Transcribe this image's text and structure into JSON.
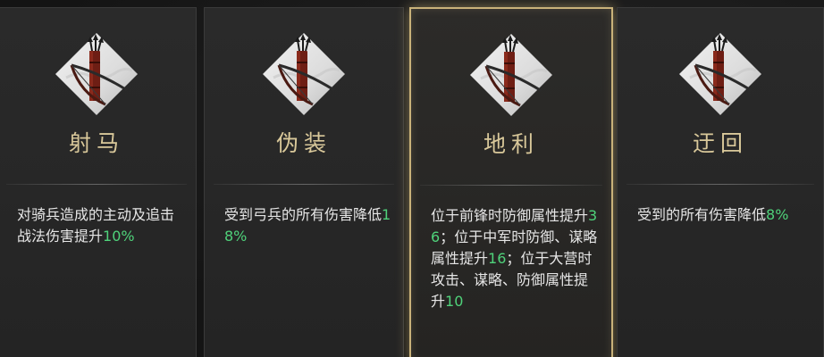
{
  "colors": {
    "highlight": "#4fd27a",
    "name_gold": "#d9c89a",
    "selected_border": "#c9b27a"
  },
  "cards": [
    {
      "name": "射马",
      "icon": "bow-quiver-icon",
      "selected": false,
      "desc": [
        {
          "t": "对骑兵造成的主动及追击战法伤害提升",
          "hl": false
        },
        {
          "t": "10",
          "hl": true
        },
        {
          "t": "%",
          "hl": true
        }
      ]
    },
    {
      "name": "伪装",
      "icon": "bow-quiver-icon",
      "selected": false,
      "desc": [
        {
          "t": "受到弓兵的所有伤害降低",
          "hl": false
        },
        {
          "t": "18%",
          "hl": true
        }
      ]
    },
    {
      "name": "地利",
      "icon": "bow-quiver-icon",
      "selected": true,
      "desc": [
        {
          "t": "位于前锋时防御属性提升",
          "hl": false
        },
        {
          "t": "36",
          "hl": true
        },
        {
          "t": "；位于中军时防御、谋略属性提升",
          "hl": false
        },
        {
          "t": "16",
          "hl": true
        },
        {
          "t": "；位于大营时攻击、谋略、防御属性提升",
          "hl": false
        },
        {
          "t": "10",
          "hl": true
        }
      ]
    },
    {
      "name": "迂回",
      "icon": "bow-quiver-icon",
      "selected": false,
      "desc": [
        {
          "t": "受到的所有伤害降低",
          "hl": false
        },
        {
          "t": "8",
          "hl": true
        },
        {
          "t": "%",
          "hl": true
        }
      ]
    }
  ]
}
